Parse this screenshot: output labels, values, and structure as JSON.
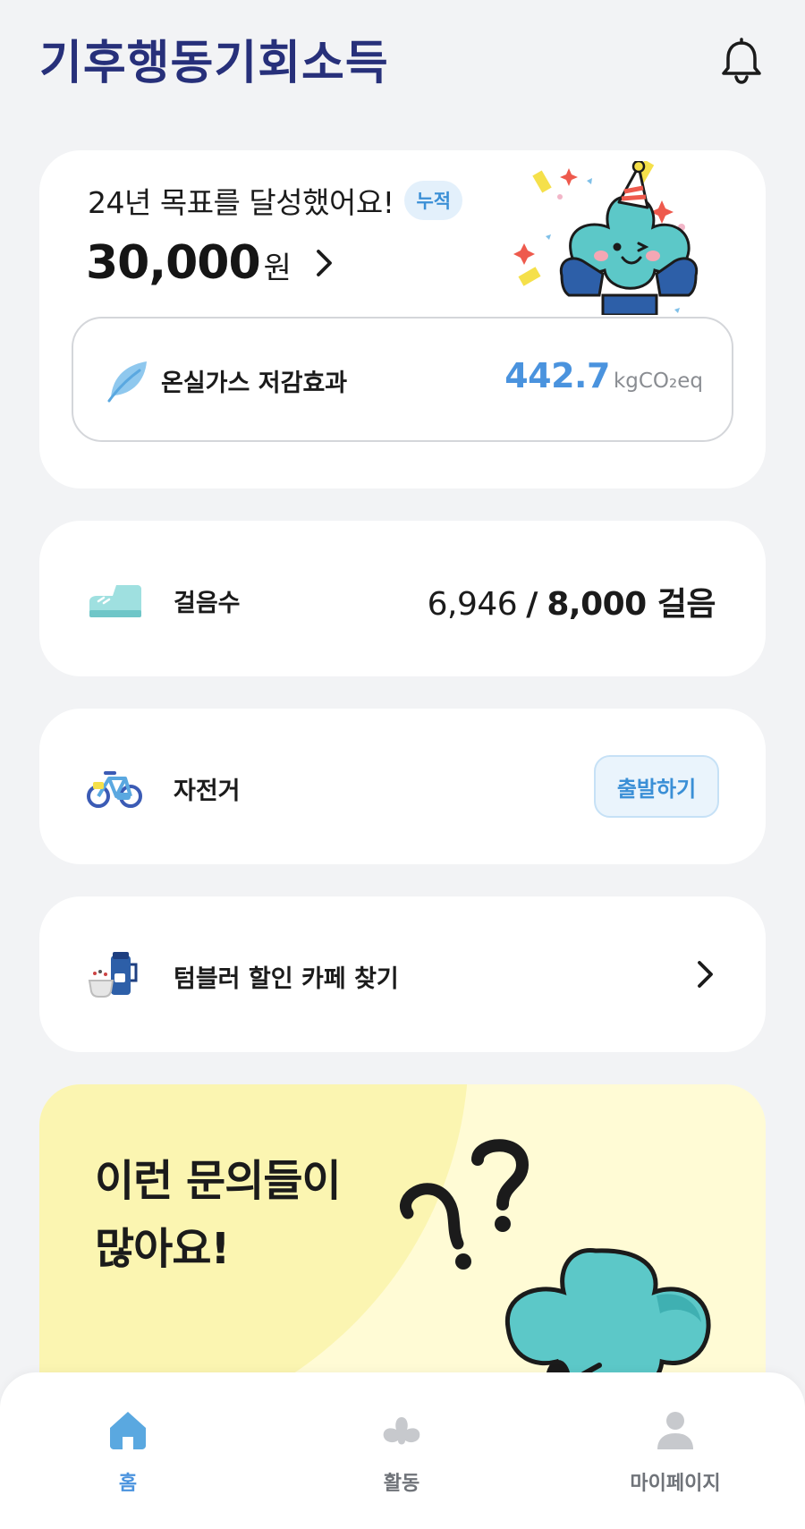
{
  "app": {
    "logo_text": "기후행동기회소득"
  },
  "goal": {
    "title": "24년 목표를 달성했어요!",
    "badge": "누적",
    "amount": "30,000",
    "amount_unit": "원"
  },
  "ghg": {
    "label": "온실가스 저감효과",
    "value": "442.7",
    "unit": "kgCO₂eq"
  },
  "steps": {
    "label": "걸음수",
    "current": "6,946",
    "separator": "/",
    "goal": "8,000 걸음"
  },
  "bike": {
    "label": "자전거",
    "button_label": "출발하기"
  },
  "tumbler": {
    "label": "텀블러 할인 카페 찾기"
  },
  "promo": {
    "title": "이런 문의들이\n많아요!"
  },
  "nav": {
    "items": [
      {
        "label": "홈",
        "icon": "home-icon",
        "active": true
      },
      {
        "label": "활동",
        "icon": "activity-icon",
        "active": false
      },
      {
        "label": "마이페이지",
        "icon": "person-icon",
        "active": false
      }
    ]
  },
  "colors": {
    "accent_blue": "#4a93de",
    "logo_navy": "#27307a",
    "logo_teal": "#3aa3a7",
    "promo_yellow": "#fffbd5",
    "mascot_teal": "#5cc8c8"
  }
}
